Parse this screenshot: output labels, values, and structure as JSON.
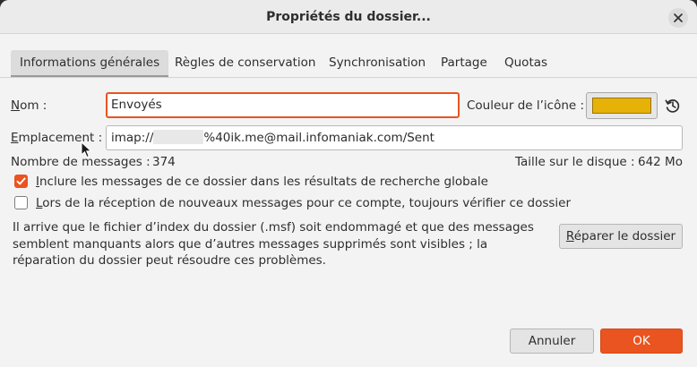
{
  "window": {
    "title": "Propriétés du dossier..."
  },
  "tabs": [
    {
      "label": "Informations générales",
      "active": true
    },
    {
      "label": "Règles de conservation",
      "active": false
    },
    {
      "label": "Synchronisation",
      "active": false
    },
    {
      "label": "Partage",
      "active": false
    },
    {
      "label": "Quotas",
      "active": false
    }
  ],
  "general": {
    "name_label_mnemonic": "N",
    "name_label_rest": "om :",
    "name_value": "Envoyés",
    "icon_color_label": "Couleur de l’icône :",
    "icon_color": "#e6b208",
    "location_label_mnemonic": "E",
    "location_label_rest": "mplacement :",
    "location_prefix": "imap://",
    "location_suffix": "%40ik.me@mail.infomaniak.com/Sent",
    "message_count_label": "Nombre de messages :",
    "message_count": "374",
    "disk_size_label": "Taille sur le disque :",
    "disk_size": "642 Mo",
    "include_global_search_mnemonic": "I",
    "include_global_search_rest": "nclure les messages de ce dossier dans les résultats de recherche globale",
    "include_global_search_checked": true,
    "always_check_mnemonic": "L",
    "always_check_rest": "ors de la réception de nouveaux messages pour ce compte, toujours vérifier ce dossier",
    "always_check_checked": false,
    "repair_info": "Il arrive que le fichier d’index du dossier (.msf) soit endommagé et que des messages semblent manquants alors que d’autres messages supprimés sont visibles ; la réparation du dossier peut résoudre ces problèmes.",
    "repair_button_mnemonic": "R",
    "repair_button_rest": "éparer le dossier"
  },
  "footer": {
    "cancel_label": "Annuler",
    "ok_label": "OK"
  },
  "colors": {
    "accent": "#e95420"
  },
  "icons": {
    "close": "close-icon",
    "reset_color": "history-reset-icon",
    "checkbox_check": "checkmark-icon",
    "mouse_cursor": "cursor-arrow-icon"
  }
}
